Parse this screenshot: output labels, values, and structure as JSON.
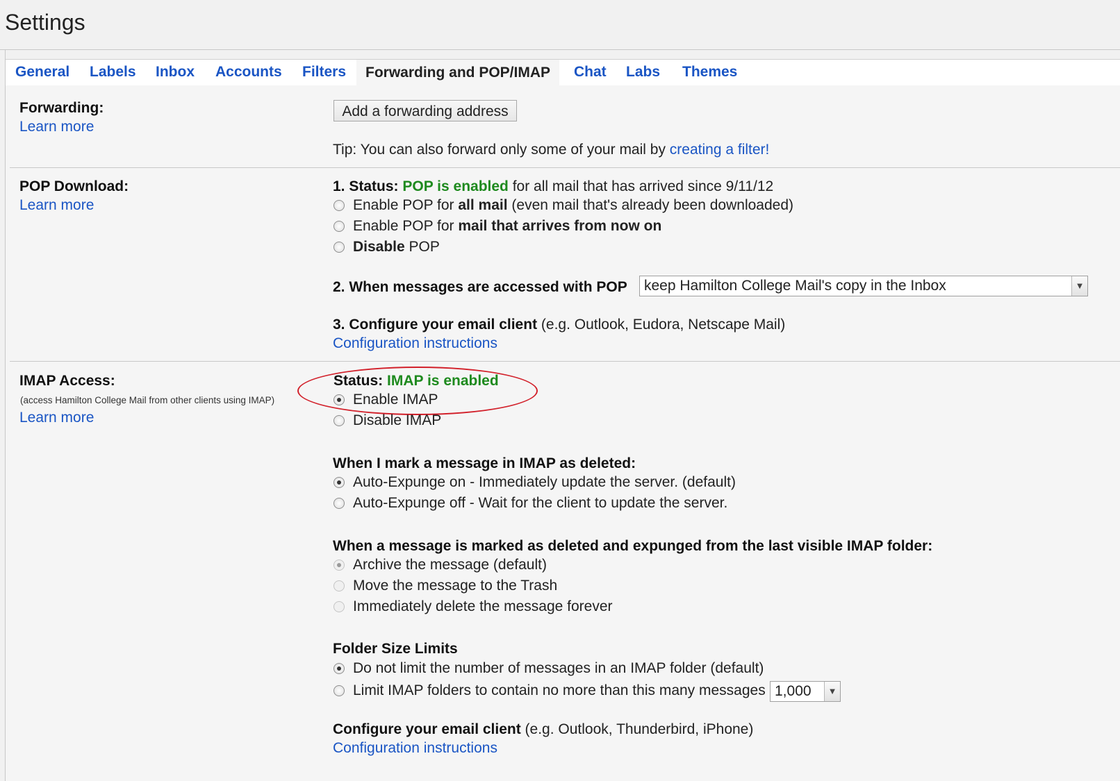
{
  "page": {
    "title": "Settings"
  },
  "tabs": [
    {
      "label": "General",
      "active": false
    },
    {
      "label": "Labels",
      "active": false
    },
    {
      "label": "Inbox",
      "active": false
    },
    {
      "label": "Accounts",
      "active": false
    },
    {
      "label": "Filters",
      "active": false
    },
    {
      "label": "Forwarding and POP/IMAP",
      "active": true
    },
    {
      "label": "Chat",
      "active": false
    },
    {
      "label": "Labs",
      "active": false
    },
    {
      "label": "Themes",
      "active": false
    }
  ],
  "forwarding": {
    "label": "Forwarding:",
    "learn_more": "Learn more",
    "add_button": "Add a forwarding address",
    "tip_prefix": "Tip: You can also forward only some of your mail by ",
    "tip_link": "creating a filter!"
  },
  "pop": {
    "label": "POP Download:",
    "learn_more": "Learn more",
    "status_prefix": "1. Status: ",
    "status_value": "POP is enabled",
    "status_suffix": " for all mail that has arrived since 9/11/12",
    "options": [
      {
        "pre": "Enable POP for ",
        "bold": "all mail",
        "post": " (even mail that's already been downloaded)",
        "checked": false
      },
      {
        "pre": "Enable POP for ",
        "bold": "mail that arrives from now on",
        "post": "",
        "checked": false
      },
      {
        "pre": "",
        "bold": "Disable",
        "post": " POP",
        "checked": false
      }
    ],
    "when_accessed_label": "2. When messages are accessed with POP",
    "when_accessed_value": "keep Hamilton College Mail's copy in the Inbox",
    "configure_bold": "3. Configure your email client",
    "configure_rest": " (e.g. Outlook, Eudora, Netscape Mail)",
    "config_link": "Configuration instructions"
  },
  "imap": {
    "label": "IMAP Access:",
    "note": "(access Hamilton College Mail from other clients using IMAP)",
    "learn_more": "Learn more",
    "status_prefix": "Status: ",
    "status_value": "IMAP is enabled",
    "enable_label": "Enable IMAP",
    "disable_label": "Disable IMAP",
    "deleted_heading": "When I mark a message in IMAP as deleted:",
    "expunge_on": "Auto-Expunge on - Immediately update the server. (default)",
    "expunge_off": "Auto-Expunge off - Wait for the client to update the server.",
    "expunged_heading": "When a message is marked as deleted and expunged from the last visible IMAP folder:",
    "archive": "Archive the message (default)",
    "trash": "Move the message to the Trash",
    "delete_forever": "Immediately delete the message forever",
    "folder_heading": "Folder Size Limits",
    "no_limit": "Do not limit the number of messages in an IMAP folder (default)",
    "limit": "Limit IMAP folders to contain no more than this many messages",
    "limit_value": "1,000",
    "configure_bold": "Configure your email client",
    "configure_rest": " (e.g. Outlook, Thunderbird, iPhone)",
    "config_link": "Configuration instructions"
  },
  "icons": {
    "dropdown": "chevron-down-icon",
    "radio": "radio-button"
  },
  "colors": {
    "link": "#1a55c4",
    "status_green": "#1e8a1e",
    "highlight_ellipse": "#d2202a"
  }
}
